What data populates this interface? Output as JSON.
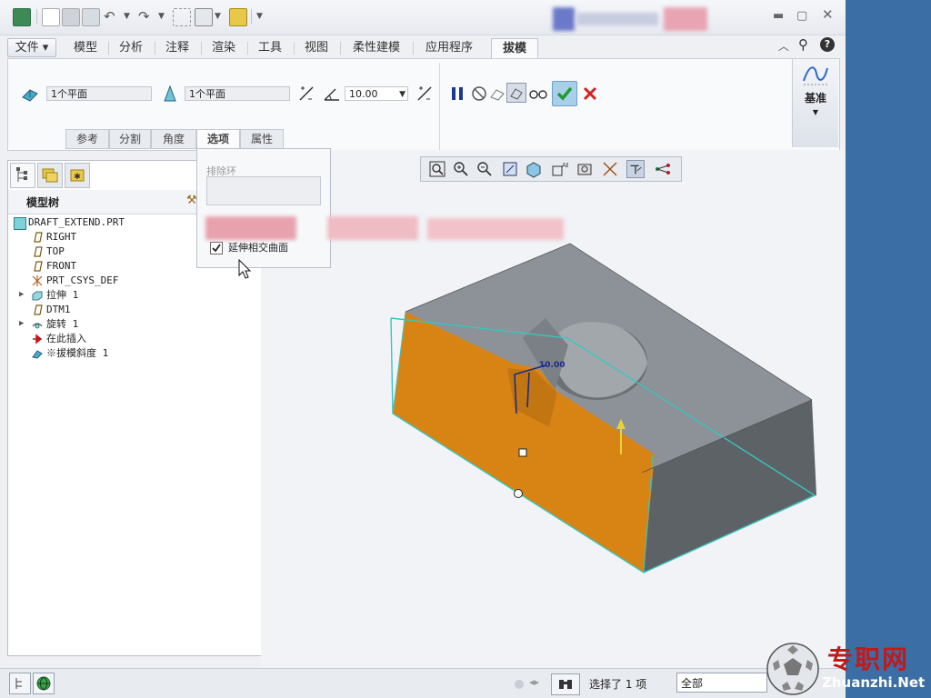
{
  "ribbon_tabs": {
    "file": "文件",
    "model": "模型",
    "analysis": "分析",
    "annotate": "注释",
    "render": "渲染",
    "tools": "工具",
    "view": "视图",
    "flexible": "柔性建模",
    "apps": "应用程序",
    "draft": "拔模"
  },
  "ribbon": {
    "surface_ref": "1个平面",
    "pivot_ref": "1个平面",
    "angle_value": "10.00",
    "datum_label": "基准"
  },
  "sub_tabs": {
    "references": "参考",
    "splits": "分割",
    "angles": "角度",
    "options": "选项",
    "properties": "属性"
  },
  "options_panel": {
    "exclude_loops_label": "排除环",
    "extend_checkbox_label": "延伸相交曲面",
    "extend_checked": true
  },
  "model_tree": {
    "title": "模型树",
    "items": [
      {
        "label": "DRAFT_EXTEND.PRT",
        "icon": "part-icon"
      },
      {
        "label": "RIGHT",
        "icon": "datum-plane-icon"
      },
      {
        "label": "TOP",
        "icon": "datum-plane-icon"
      },
      {
        "label": "FRONT",
        "icon": "datum-plane-icon"
      },
      {
        "label": "PRT_CSYS_DEF",
        "icon": "csys-icon"
      },
      {
        "label": "拉伸 1",
        "icon": "extrude-icon"
      },
      {
        "label": "DTM1",
        "icon": "datum-plane-icon"
      },
      {
        "label": "旋转 1",
        "icon": "revolve-icon"
      },
      {
        "label": "在此插入",
        "icon": "insert-here-arrow-icon"
      },
      {
        "label": "※拔模斜度 1",
        "icon": "draft-icon"
      }
    ]
  },
  "viewport": {
    "dimension_label": "10.00"
  },
  "status": {
    "selected_text": "选择了 1 项",
    "filter_value": "全部"
  },
  "watermark": {
    "cn": "专职网",
    "en": "Zhuanzhi.Net"
  },
  "colors": {
    "accent_blue": "#3a6ea5",
    "face_orange": "#d88414",
    "body_gray": "#8d9298",
    "cyan_outline": "#37c6c0"
  }
}
